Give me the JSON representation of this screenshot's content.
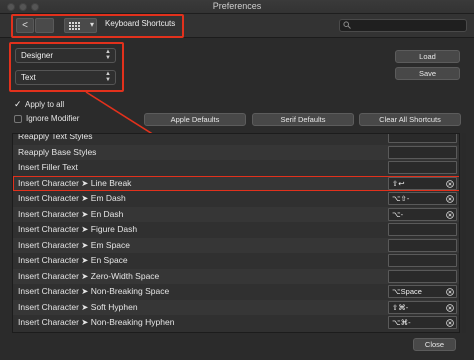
{
  "window": {
    "title": "Preferences"
  },
  "toolbar": {
    "back_glyph": "<",
    "forward_glyph": "",
    "grid_dropdown_glyph": "▾",
    "section_title": "Keyboard Shortcuts",
    "search_placeholder": ""
  },
  "settings": {
    "app_select": "Designer",
    "category_select": "Text",
    "apply_to_all_label": "Apply to all",
    "apply_to_all_checked": true,
    "ignore_modifier_label": "Ignore Modifier",
    "ignore_modifier_checked": false
  },
  "buttons": {
    "load": "Load",
    "save": "Save",
    "apple_defaults": "Apple Defaults",
    "serif_defaults": "Serif Defaults",
    "clear_all": "Clear All Shortcuts",
    "close": "Close"
  },
  "rows": [
    {
      "label": "Reapply Text Styles",
      "shortcut": ""
    },
    {
      "label": "Reapply Base Styles",
      "shortcut": ""
    },
    {
      "label": "Insert Filler Text",
      "shortcut": ""
    },
    {
      "label": "Insert Character ➤ Line Break",
      "shortcut": "⇧↩",
      "highlighted": true
    },
    {
      "label": "Insert Character ➤ Em Dash",
      "shortcut": "⌥⇧-"
    },
    {
      "label": "Insert Character ➤ En Dash",
      "shortcut": "⌥-"
    },
    {
      "label": "Insert Character ➤ Figure Dash",
      "shortcut": ""
    },
    {
      "label": "Insert Character ➤ Em Space",
      "shortcut": ""
    },
    {
      "label": "Insert Character ➤ En Space",
      "shortcut": ""
    },
    {
      "label": "Insert Character ➤ Zero-Width Space",
      "shortcut": ""
    },
    {
      "label": "Insert Character ➤ Non-Breaking Space",
      "shortcut": "⌥Space"
    },
    {
      "label": "Insert Character ➤ Soft Hyphen",
      "shortcut": "⇧⌘-"
    },
    {
      "label": "Insert Character ➤ Non-Breaking Hyphen",
      "shortcut": "⌥⌘-"
    }
  ],
  "colors": {
    "annotation_red": "#e2311c",
    "background": "#2b2b2b"
  }
}
